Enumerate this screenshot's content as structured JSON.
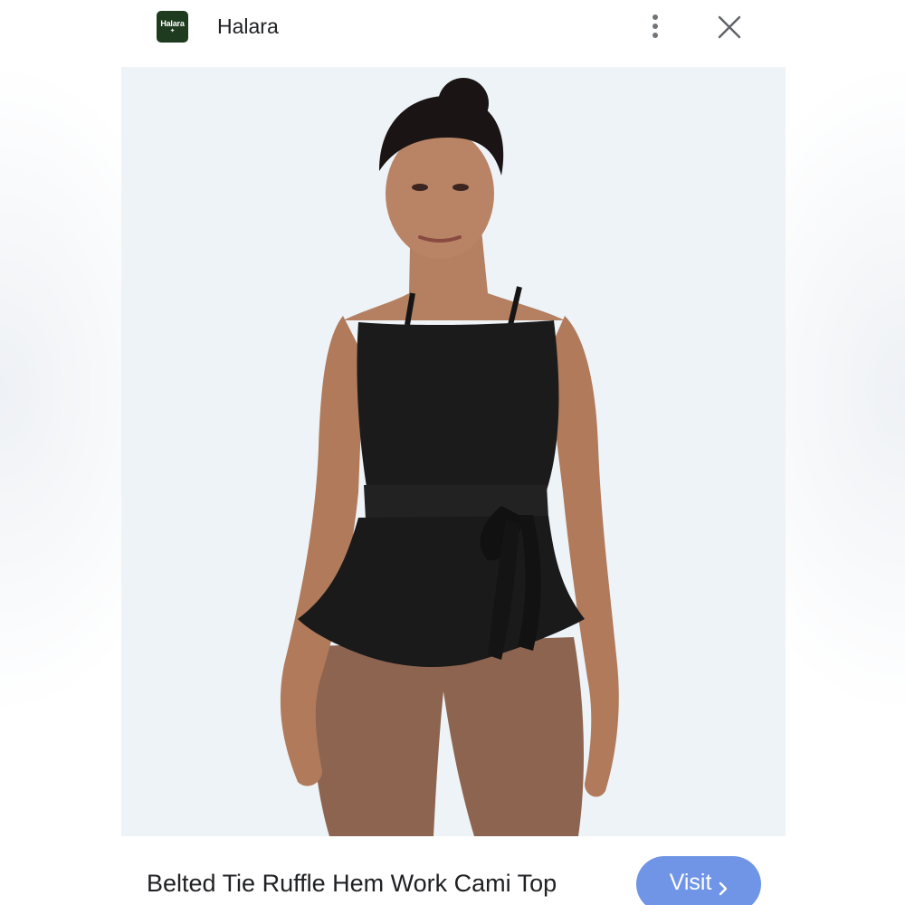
{
  "header": {
    "brand_logo_text": "Halara",
    "brand_name": "Halara",
    "more_icon": "more-vert-icon",
    "close_icon": "close-icon"
  },
  "product": {
    "image_description_icon": "product-photo",
    "title": "Belted Tie Ruffle Hem Work Cami Top"
  },
  "actions": {
    "visit_label": "Visit",
    "visit_icon": "chevron-right-icon"
  },
  "colors": {
    "brand_logo_bg": "#1f3b1f",
    "visit_button_bg": "#7095e6",
    "image_bg": "#eef3f7",
    "text": "#202124"
  }
}
